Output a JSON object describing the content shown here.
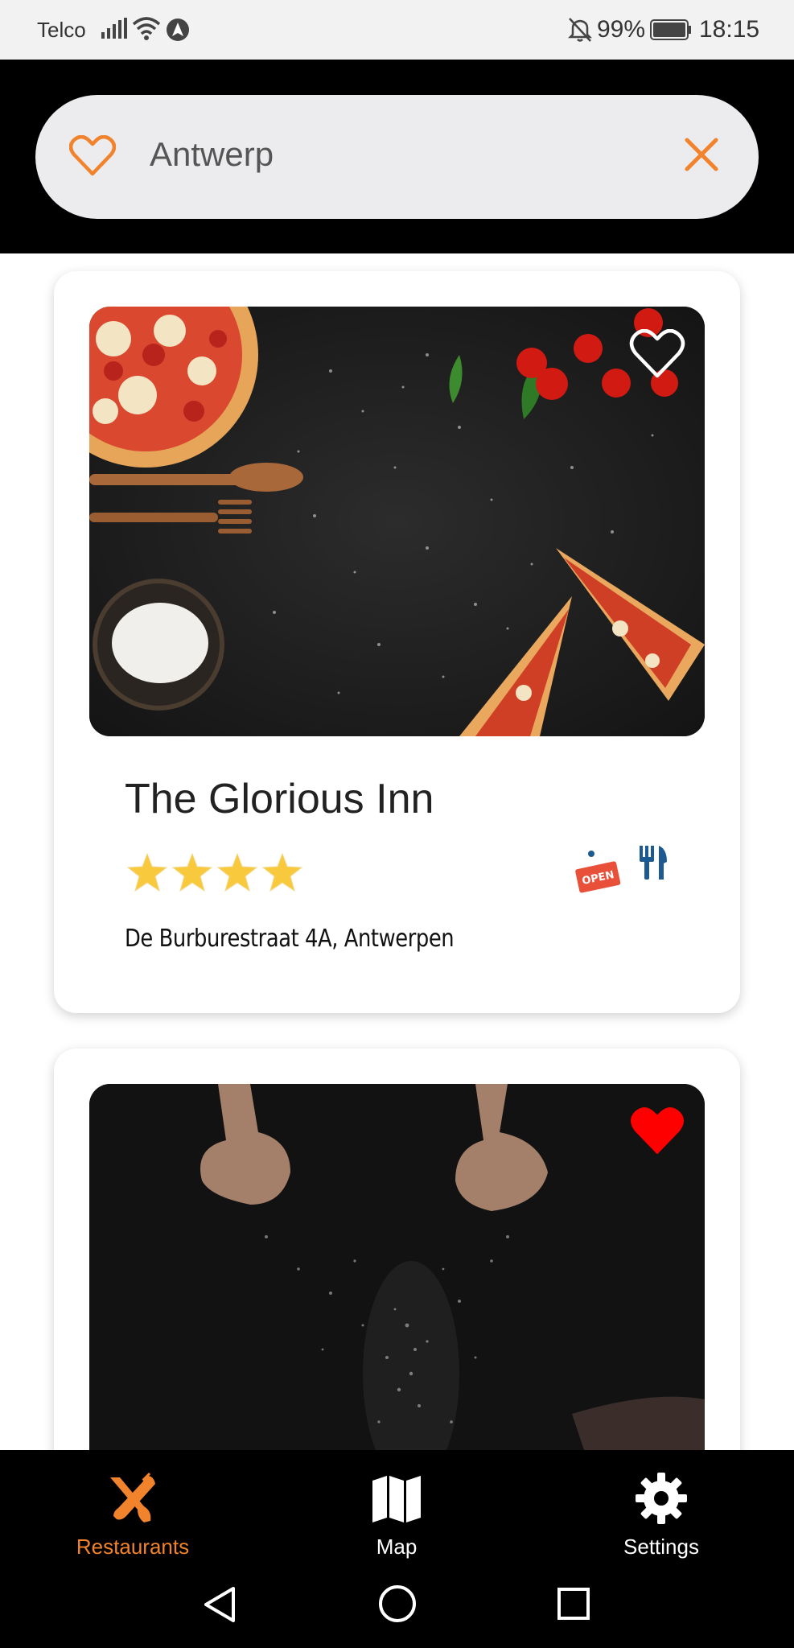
{
  "status_bar": {
    "carrier": "Telco",
    "battery": "99%",
    "time": "18:15"
  },
  "search": {
    "query": "Antwerp",
    "placeholder": ""
  },
  "restaurants": [
    {
      "name": "The Glorious Inn",
      "address": "De Burburestraat 4A, Antwerpen",
      "rating": 4,
      "favorite": false,
      "open_label": "OPEN",
      "icons": [
        "open-sign-icon",
        "cutlery-icon"
      ]
    },
    {
      "name": "",
      "address": "",
      "favorite": true
    }
  ],
  "bottom_nav": {
    "items": [
      {
        "label": "Restaurants",
        "icon": "restaurants-icon",
        "active": true
      },
      {
        "label": "Map",
        "icon": "map-icon",
        "active": false
      },
      {
        "label": "Settings",
        "icon": "gear-icon",
        "active": false
      }
    ]
  },
  "colors": {
    "accent": "#f0832c",
    "favorite_red": "#ff0000",
    "star": "#f8c93d",
    "cutlery": "#1e5a92",
    "open_sign": "#e8503a"
  }
}
